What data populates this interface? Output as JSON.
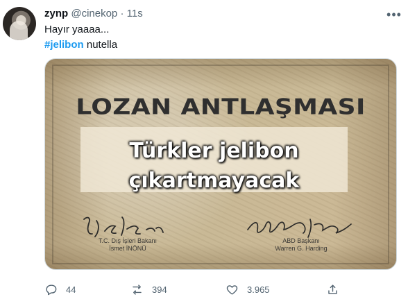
{
  "tweet": {
    "name": "zynp",
    "handle": "@cinekop",
    "dot": "·",
    "time": "11s",
    "text_line1": "Hayır yaaaa...",
    "hashtag": "#jelibon",
    "text_line2_rest": " nutella"
  },
  "image": {
    "title": "LOZAN ANTLAŞMASI",
    "overlay_line1": "Türkler jelibon",
    "overlay_line2": "çıkartmayacak",
    "left_caption_line1": "T.C. Dış İşleri Bakanı",
    "left_caption_line2": "İsmet İNÖNÜ",
    "right_caption_line1": "ABD Başkanı",
    "right_caption_line2": "Warren G. Harding"
  },
  "actions": {
    "reply_count": "44",
    "retweet_count": "394",
    "like_count": "3.965"
  },
  "icons": {
    "avatar": "profile-avatar",
    "more": "more-icon",
    "reply": "reply-icon",
    "retweet": "retweet-icon",
    "like": "heart-icon",
    "share": "share-icon"
  },
  "colors": {
    "hashtag": "#1d9bf0",
    "muted": "#536471",
    "paper": "#c9b996"
  }
}
